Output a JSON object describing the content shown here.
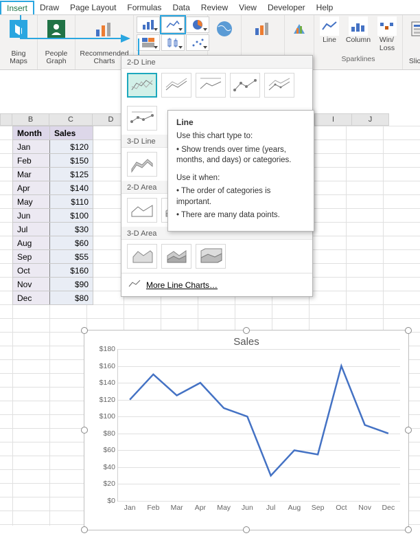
{
  "ribbon": {
    "tabs": [
      "Insert",
      "Draw",
      "Page Layout",
      "Formulas",
      "Data",
      "Review",
      "View",
      "Developer",
      "Help"
    ],
    "active_tab": "Insert",
    "groups": {
      "bing_maps": "Bing\nMaps",
      "people_graph": "People\nGraph",
      "recommended_charts": "Recommended\nCharts",
      "maps": "Maps",
      "pivotchart": "PivotChart",
      "three_d": "3D",
      "line": "Line",
      "column": "Column",
      "winloss": "Win/\nLoss",
      "slicer": "Slicer",
      "sparklines_label": "Sparklines"
    }
  },
  "dropdown": {
    "sections": {
      "line2d": "2-D Line",
      "line3d": "3-D Line",
      "area2d": "2-D Area",
      "area3d": "3-D Area"
    },
    "more": "More Line Charts…"
  },
  "tooltip": {
    "title": "Line",
    "p1": "Use this chart type to:",
    "b1": "• Show trends over time (years, months, and days) or categories.",
    "p2": "Use it when:",
    "b2": "• The order of categories is important.",
    "b3": "• There are many data points."
  },
  "columns": {
    "b": "B",
    "c": "C",
    "d": "D",
    "i": "I",
    "j": "J"
  },
  "table": {
    "headers": {
      "month": "Month",
      "sales": "Sales"
    },
    "rows": [
      {
        "m": "Jan",
        "s": "$120"
      },
      {
        "m": "Feb",
        "s": "$150"
      },
      {
        "m": "Mar",
        "s": "$125"
      },
      {
        "m": "Apr",
        "s": "$140"
      },
      {
        "m": "May",
        "s": "$110"
      },
      {
        "m": "Jun",
        "s": "$100"
      },
      {
        "m": "Jul",
        "s": "$30"
      },
      {
        "m": "Aug",
        "s": "$60"
      },
      {
        "m": "Sep",
        "s": "$55"
      },
      {
        "m": "Oct",
        "s": "$160"
      },
      {
        "m": "Nov",
        "s": "$90"
      },
      {
        "m": "Dec",
        "s": "$80"
      }
    ]
  },
  "chart_data": {
    "type": "line",
    "title": "Sales",
    "categories": [
      "Jan",
      "Feb",
      "Mar",
      "Apr",
      "May",
      "Jun",
      "Jul",
      "Aug",
      "Sep",
      "Oct",
      "Nov",
      "Dec"
    ],
    "values": [
      120,
      150,
      125,
      140,
      110,
      100,
      30,
      60,
      55,
      160,
      90,
      80
    ],
    "ylim": [
      0,
      180
    ],
    "ystep": 20,
    "ylabel": "",
    "xlabel": ""
  }
}
